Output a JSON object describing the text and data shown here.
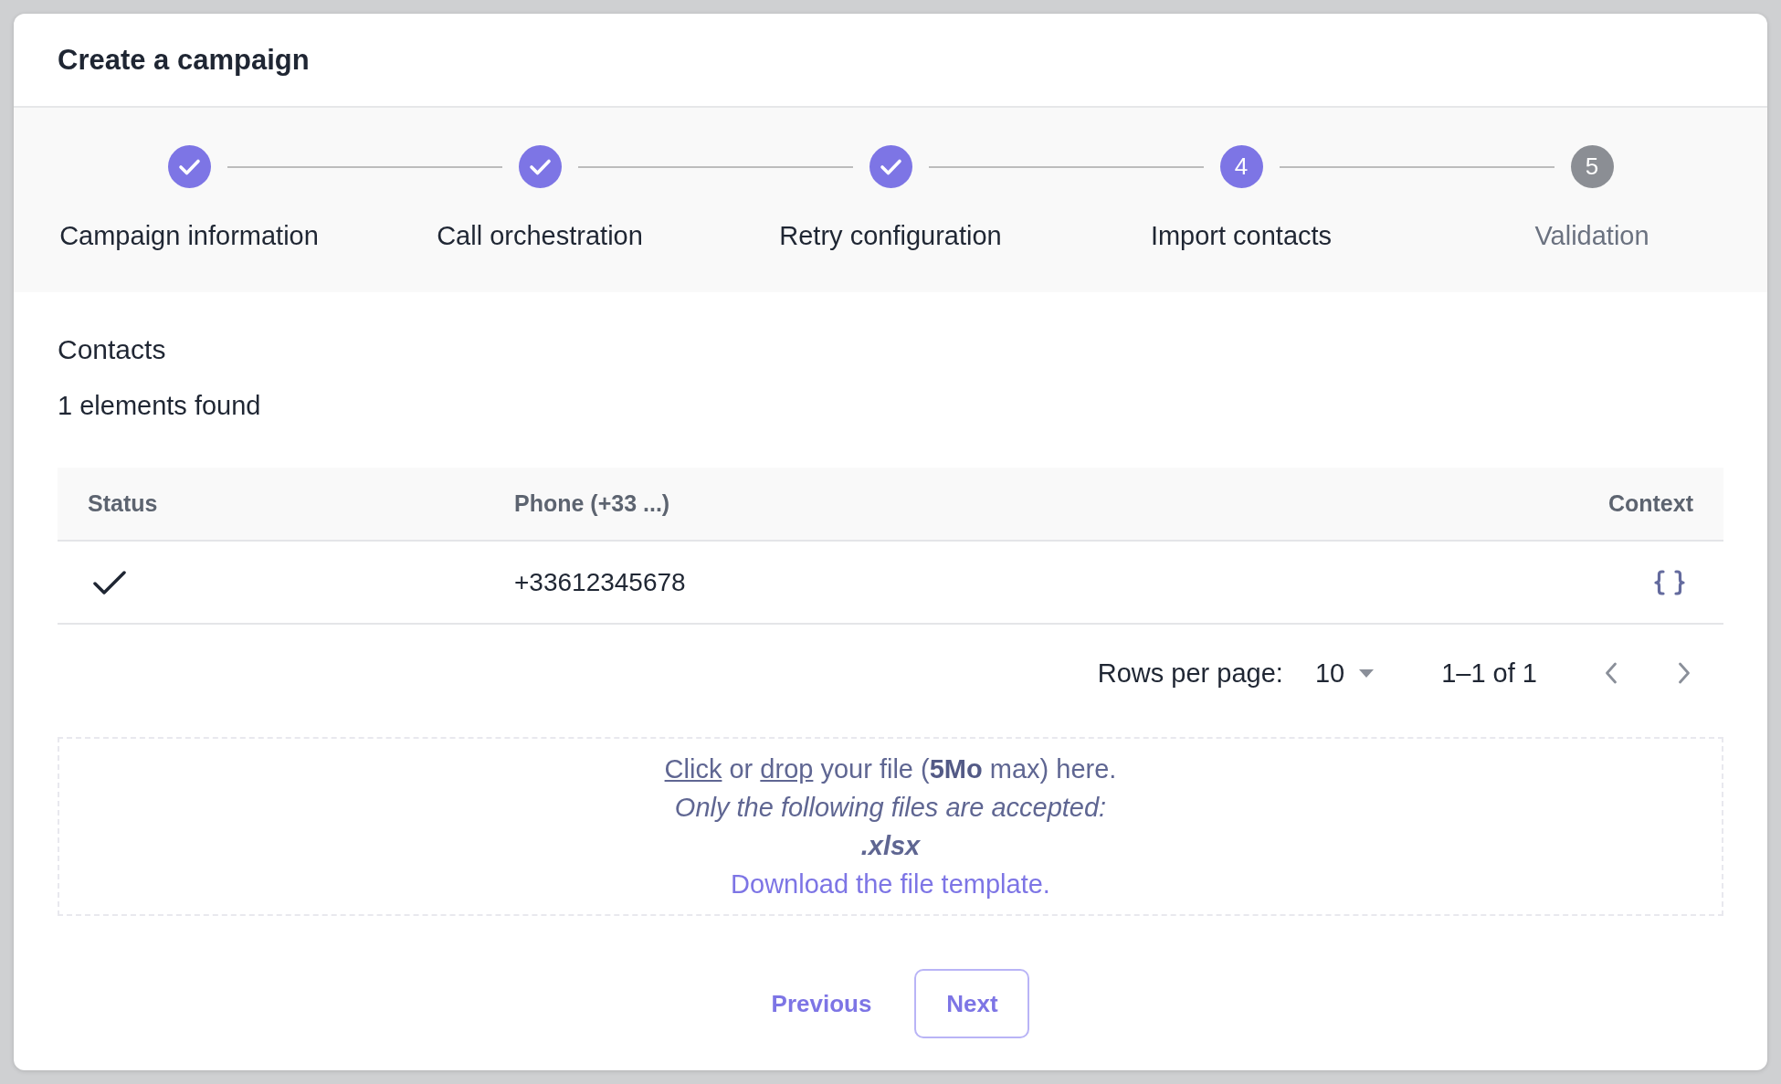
{
  "dialog": {
    "title": "Create a campaign"
  },
  "steps": [
    {
      "label": "Campaign information",
      "completed": true,
      "current": false
    },
    {
      "label": "Call orchestration",
      "completed": true,
      "current": false
    },
    {
      "label": "Retry configuration",
      "completed": true,
      "current": false
    },
    {
      "number": "4",
      "label": "Import contacts",
      "completed": false,
      "current": true
    },
    {
      "number": "5",
      "label": "Validation",
      "completed": false,
      "current": false
    }
  ],
  "contacts": {
    "heading": "Contacts",
    "count": "1 elements found"
  },
  "table": {
    "columns": [
      {
        "label": "Status"
      },
      {
        "label": "Phone (+33 ...)"
      },
      {
        "label": "Context"
      }
    ],
    "rows": [
      {
        "valid": true,
        "phone": "+33612345678"
      }
    ]
  },
  "pagination": {
    "rows_per_page_label": "Rows per page:",
    "rows_per_page": "10",
    "range": "1–1 of 1"
  },
  "dropzone": {
    "prompt": [
      {
        "kind": "link",
        "text": "Click"
      },
      {
        "kind": "text",
        "text": " or "
      },
      {
        "kind": "link",
        "text": "drop"
      },
      {
        "kind": "text",
        "text": " your file (**5Mo** max) here."
      }
    ],
    "accepted_label": "Only the following files are accepted:",
    "accepted_types": [
      ".xlsx"
    ],
    "template_link": "Download the file template."
  },
  "footer": {
    "buttons": [
      {
        "kind": "text",
        "label": "Previous"
      },
      {
        "kind": "outlined",
        "label": "Next"
      }
    ]
  }
}
